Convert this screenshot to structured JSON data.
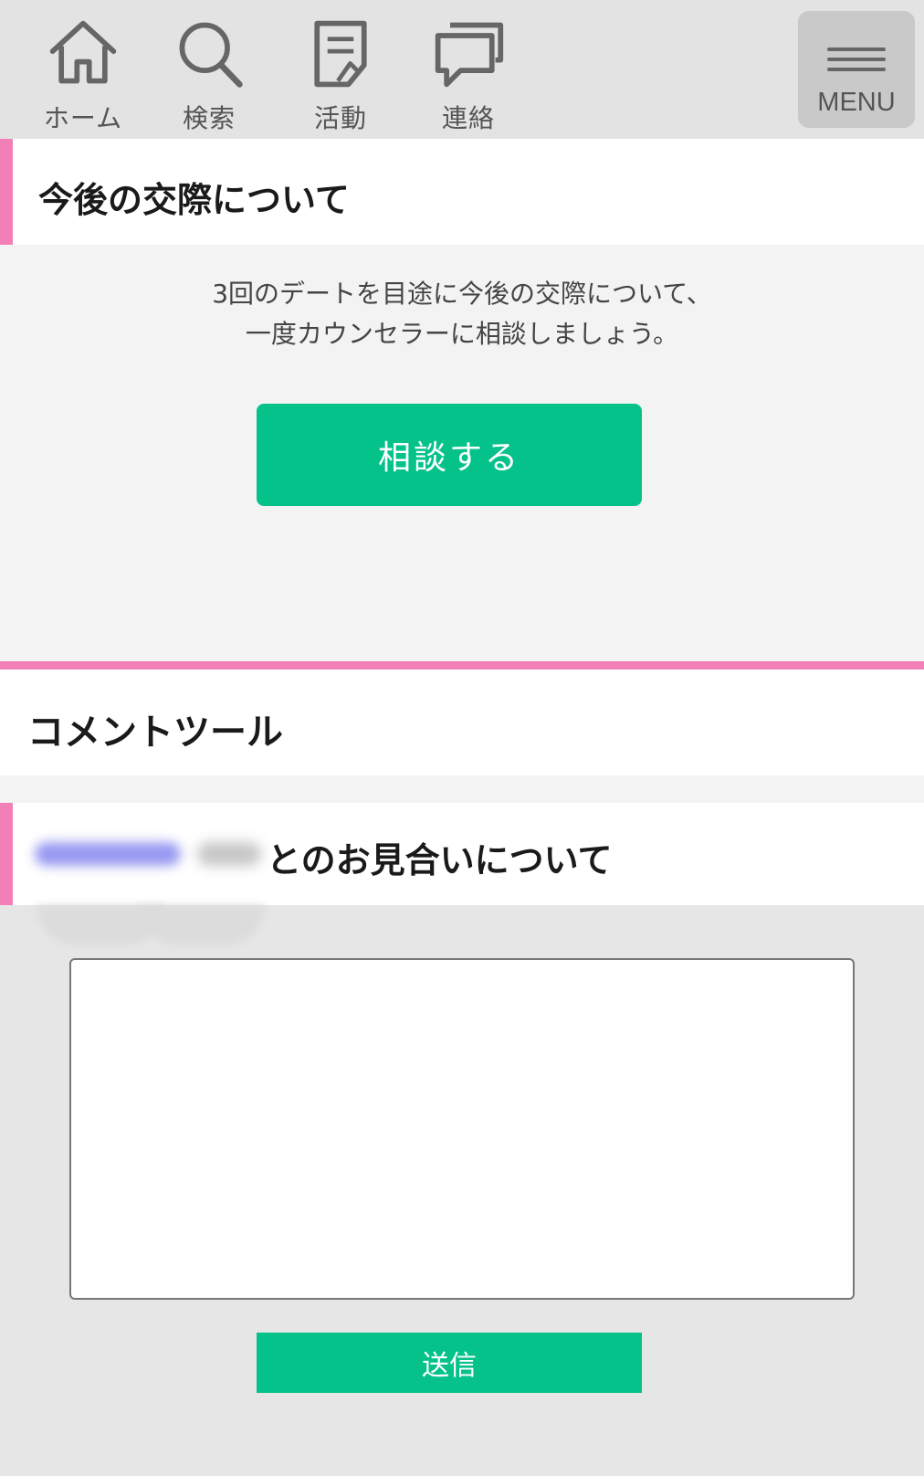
{
  "nav": {
    "items": [
      {
        "label": "ホーム",
        "icon": "home-icon"
      },
      {
        "label": "検索",
        "icon": "search-icon"
      },
      {
        "label": "活動",
        "icon": "document-icon"
      },
      {
        "label": "連絡",
        "icon": "chat-icon"
      }
    ],
    "menu_label": "MENU"
  },
  "future_section": {
    "title": "今後の交際について",
    "message_line1": "3回のデートを目途に今後の交際について、",
    "message_line2": "一度カウンセラーに相談しましょう。",
    "consult_button": "相談する"
  },
  "comment_tool": {
    "title": "コメントツール",
    "subtitle_suffix": "とのお見合いについて",
    "textarea_value": "",
    "send_button": "送信"
  },
  "colors": {
    "accent_pink": "#f27fb8",
    "button_green": "#05c28a"
  }
}
